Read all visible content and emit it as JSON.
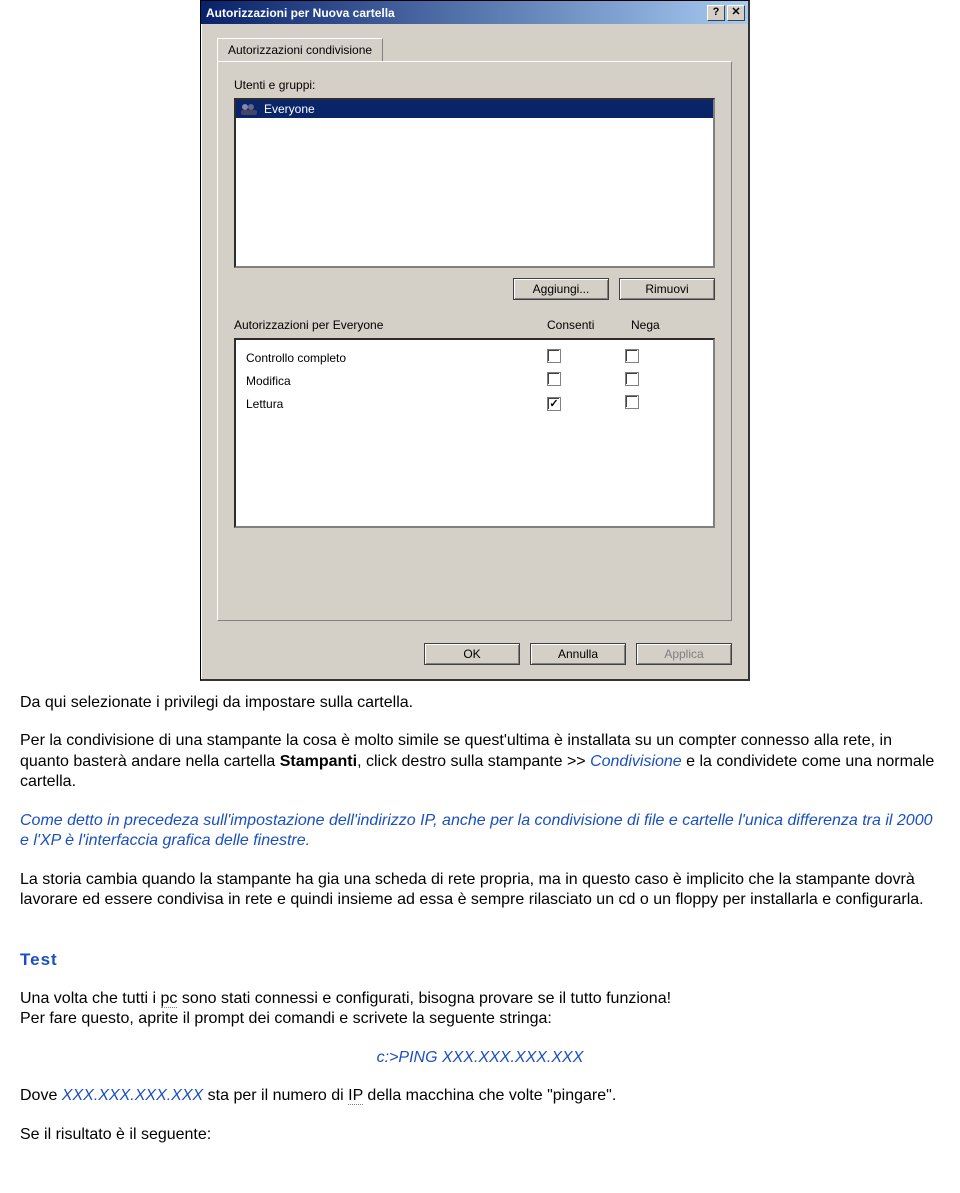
{
  "dialog": {
    "title": "Autorizzazioni per Nuova cartella",
    "help_glyph": "?",
    "close_glyph": "✕",
    "tab_label": "Autorizzazioni condivisione",
    "users_label": "Utenti e gruppi:",
    "list_item": "Everyone",
    "add_btn": "Aggiungi...",
    "remove_btn": "Rimuovi",
    "perm_header_label": "Autorizzazioni per Everyone",
    "perm_allow": "Consenti",
    "perm_deny": "Nega",
    "permissions": [
      {
        "label": "Controllo completo",
        "allow": false,
        "deny": false
      },
      {
        "label": "Modifica",
        "allow": false,
        "deny": false
      },
      {
        "label": "Lettura",
        "allow": true,
        "deny": false
      }
    ],
    "ok": "OK",
    "cancel": "Annulla",
    "apply": "Applica"
  },
  "article": {
    "p1": "Da qui selezionate i privilegi da impostare sulla cartella.",
    "p2_a": "Per la condivisione di una stampante la cosa è molto simile se quest'ultima è installata su un compter connesso alla rete, in quanto basterà andare nella cartella ",
    "p2_b": "Stampanti",
    "p2_c": ", click destro sulla stampante >> ",
    "p2_d": "Condivisione",
    "p2_e": " e la condividete come una normale cartella.",
    "p3": "Come detto in precedeza sull'impostazione dell'indirizzo IP, anche per la condivisione di file e cartelle l'unica differenza tra il 2000 e l'XP è l'interfaccia grafica delle finestre.",
    "p4": "La storia cambia quando la stampante ha gia una scheda di rete propria, ma in questo caso è implicito che la stampante dovrà lavorare ed essere condivisa in rete e quindi insieme ad essa è sempre rilasciato un cd o un floppy per installarla e configurarla.",
    "test_head": "Test",
    "p5_a": "Una volta che tutti i ",
    "p5_pc": "pc",
    "p5_b": " sono stati connessi e configurati, bisogna provare se il tutto funziona!",
    "p6": "Per fare questo, aprite il prompt dei comandi e scrivete la seguente stringa:",
    "cmd": "c:>PING XXX.XXX.XXX.XXX",
    "p7_a": "Dove ",
    "p7_ip": "XXX.XXX.XXX.XXX",
    "p7_b": " sta per il numero di ",
    "p7_iplink": "IP",
    "p7_c": " della macchina che volte \"pingare\".",
    "p8": "Se il risultato è il seguente:"
  }
}
